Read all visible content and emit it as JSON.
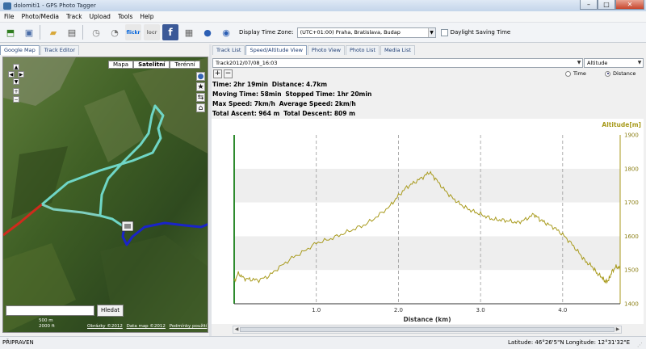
{
  "window": {
    "title": "dolomiti1 - GPS Photo Tagger",
    "close_label": "✕",
    "minimize_label": "–",
    "maximize_label": "□"
  },
  "menu": [
    "File",
    "Photo/Media",
    "Track",
    "Upload",
    "Tools",
    "Help"
  ],
  "toolbar": {
    "flickr_label": "flickr",
    "locr_label": "locr",
    "facebook_label": "f",
    "timezone_label": "Display Time Zone:",
    "timezone_value": "(UTC+01:00) Praha, Bratislava, Budap",
    "dst_label": "Daylight Saving Time",
    "dst_checked": false
  },
  "left_tabs": [
    "Google Map",
    "Track Editor"
  ],
  "left_active_tab": 0,
  "map": {
    "type_buttons": [
      "Mapa",
      "Satelitní",
      "Terénní"
    ],
    "search_placeholder": "",
    "search_button": "Hledat",
    "scale_top": "500 m",
    "scale_bottom": "2000 ft",
    "footer_links": [
      "Obrázky ©2012",
      "Data map ©2012",
      "Podmínky použití"
    ]
  },
  "right_tabs": [
    "Track List",
    "Speed/Altitude View",
    "Photo View",
    "Photo List",
    "Media List"
  ],
  "right_active_tab": 1,
  "track_select": "Track2012/07/08_16:03",
  "series_select": "Altitude",
  "axis_mode": {
    "options": [
      "Time",
      "Distance"
    ],
    "selected": "Distance"
  },
  "stats": {
    "time_label": "Time:",
    "time_value": "2hr 19min",
    "distance_label": "Distance:",
    "distance_value": "4.7km",
    "moving_label": "Moving Time:",
    "moving_value": "58min",
    "stopped_label": "Stopped Time:",
    "stopped_value": "1hr 20min",
    "maxspeed_label": "Max Speed:",
    "maxspeed_value": "7km/h",
    "avgspeed_label": "Average Speed:",
    "avgspeed_value": "2km/h",
    "ascent_label": "Total Ascent:",
    "ascent_value": "964 m",
    "descent_label": "Total Descent:",
    "descent_value": "809 m"
  },
  "chart_data": {
    "type": "line",
    "xlabel": "Distance (km)",
    "ylabel": "Altitude[m]",
    "xlim": [
      0,
      4.7
    ],
    "ylim": [
      1400,
      1900
    ],
    "xticks": [
      "1.0",
      "2.0",
      "3.0",
      "4.0"
    ],
    "yticks": [
      "1400",
      "1500",
      "1600",
      "1700",
      "1800",
      "1900"
    ],
    "grid": true,
    "series": [
      {
        "color": "#a89a1c",
        "x": [
          0.0,
          0.05,
          0.12,
          0.2,
          0.3,
          0.42,
          0.55,
          0.7,
          0.85,
          1.0,
          1.15,
          1.3,
          1.45,
          1.6,
          1.75,
          1.9,
          2.0,
          2.1,
          2.2,
          2.3,
          2.38,
          2.45,
          2.55,
          2.65,
          2.75,
          2.85,
          2.95,
          3.05,
          3.15,
          3.25,
          3.35,
          3.45,
          3.55,
          3.65,
          3.72,
          3.8,
          3.9,
          4.0,
          4.1,
          4.2,
          4.28,
          4.36,
          4.42,
          4.48,
          4.52,
          4.56,
          4.6,
          4.65,
          4.7
        ],
        "y": [
          1465,
          1490,
          1475,
          1472,
          1470,
          1482,
          1508,
          1535,
          1555,
          1580,
          1590,
          1605,
          1620,
          1635,
          1660,
          1690,
          1720,
          1745,
          1760,
          1775,
          1790,
          1770,
          1740,
          1715,
          1695,
          1680,
          1670,
          1660,
          1650,
          1648,
          1645,
          1640,
          1650,
          1665,
          1650,
          1638,
          1625,
          1605,
          1580,
          1550,
          1525,
          1510,
          1490,
          1478,
          1465,
          1470,
          1495,
          1510,
          1505
        ]
      }
    ]
  },
  "status": {
    "left": "PŘIPRAVEN",
    "right": "Latitude: 46°26'5\"N Longitude: 12°31'32\"E"
  }
}
